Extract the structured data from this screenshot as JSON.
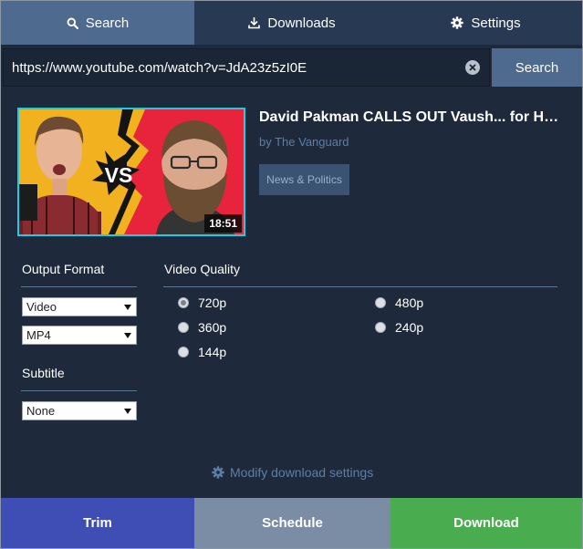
{
  "tabs": [
    {
      "label": "Search",
      "icon": "search-icon",
      "active": true
    },
    {
      "label": "Downloads",
      "icon": "download-icon",
      "active": false
    },
    {
      "label": "Settings",
      "icon": "gear-icon",
      "active": false
    }
  ],
  "search": {
    "url_value": "https://www.youtube.com/watch?v=JdA23z5zI0E",
    "button_label": "Search"
  },
  "video": {
    "title": "David Pakman CALLS OUT Vaush... for His C...",
    "channel": "by The Vanguard",
    "category": "News & Politics",
    "duration": "18:51",
    "thumbnail_text": "VS"
  },
  "format": {
    "output_format_label": "Output Format",
    "type_value": "Video",
    "container_value": "MP4",
    "subtitle_label": "Subtitle",
    "subtitle_value": "None"
  },
  "quality": {
    "label": "Video Quality",
    "options": [
      "720p",
      "480p",
      "360p",
      "240p",
      "144p"
    ],
    "selected": "720p"
  },
  "modify_link": "Modify download settings",
  "actions": {
    "trim": "Trim",
    "schedule": "Schedule",
    "download": "Download"
  },
  "colors": {
    "background": "#1e2a3c",
    "tab_active": "#4f6a8f",
    "tab_inactive": "#283a53",
    "trim": "#3e4eb4",
    "schedule": "#7a8da5",
    "download": "#49ad4f",
    "thumbnail_border": "#17d0e8",
    "link": "#5d7ea4"
  }
}
